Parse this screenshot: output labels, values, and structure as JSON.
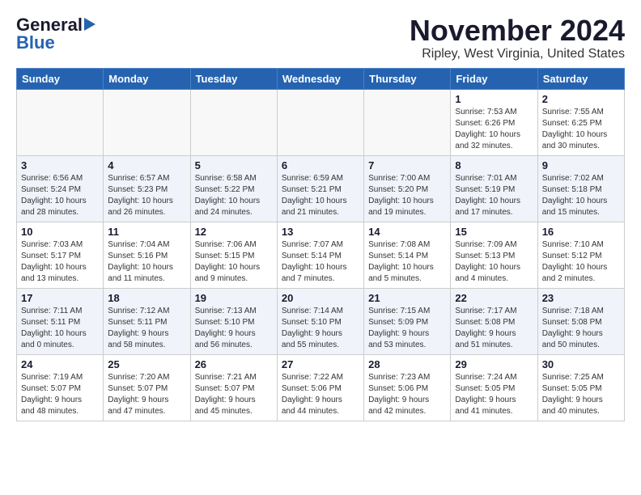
{
  "header": {
    "logo_general": "General",
    "logo_blue": "Blue",
    "title": "November 2024",
    "subtitle": "Ripley, West Virginia, United States"
  },
  "weekdays": [
    "Sunday",
    "Monday",
    "Tuesday",
    "Wednesday",
    "Thursday",
    "Friday",
    "Saturday"
  ],
  "weeks": [
    {
      "shaded": false,
      "days": [
        {
          "num": "",
          "info": ""
        },
        {
          "num": "",
          "info": ""
        },
        {
          "num": "",
          "info": ""
        },
        {
          "num": "",
          "info": ""
        },
        {
          "num": "",
          "info": ""
        },
        {
          "num": "1",
          "info": "Sunrise: 7:53 AM\nSunset: 6:26 PM\nDaylight: 10 hours\nand 32 minutes."
        },
        {
          "num": "2",
          "info": "Sunrise: 7:55 AM\nSunset: 6:25 PM\nDaylight: 10 hours\nand 30 minutes."
        }
      ]
    },
    {
      "shaded": true,
      "days": [
        {
          "num": "3",
          "info": "Sunrise: 6:56 AM\nSunset: 5:24 PM\nDaylight: 10 hours\nand 28 minutes."
        },
        {
          "num": "4",
          "info": "Sunrise: 6:57 AM\nSunset: 5:23 PM\nDaylight: 10 hours\nand 26 minutes."
        },
        {
          "num": "5",
          "info": "Sunrise: 6:58 AM\nSunset: 5:22 PM\nDaylight: 10 hours\nand 24 minutes."
        },
        {
          "num": "6",
          "info": "Sunrise: 6:59 AM\nSunset: 5:21 PM\nDaylight: 10 hours\nand 21 minutes."
        },
        {
          "num": "7",
          "info": "Sunrise: 7:00 AM\nSunset: 5:20 PM\nDaylight: 10 hours\nand 19 minutes."
        },
        {
          "num": "8",
          "info": "Sunrise: 7:01 AM\nSunset: 5:19 PM\nDaylight: 10 hours\nand 17 minutes."
        },
        {
          "num": "9",
          "info": "Sunrise: 7:02 AM\nSunset: 5:18 PM\nDaylight: 10 hours\nand 15 minutes."
        }
      ]
    },
    {
      "shaded": false,
      "days": [
        {
          "num": "10",
          "info": "Sunrise: 7:03 AM\nSunset: 5:17 PM\nDaylight: 10 hours\nand 13 minutes."
        },
        {
          "num": "11",
          "info": "Sunrise: 7:04 AM\nSunset: 5:16 PM\nDaylight: 10 hours\nand 11 minutes."
        },
        {
          "num": "12",
          "info": "Sunrise: 7:06 AM\nSunset: 5:15 PM\nDaylight: 10 hours\nand 9 minutes."
        },
        {
          "num": "13",
          "info": "Sunrise: 7:07 AM\nSunset: 5:14 PM\nDaylight: 10 hours\nand 7 minutes."
        },
        {
          "num": "14",
          "info": "Sunrise: 7:08 AM\nSunset: 5:14 PM\nDaylight: 10 hours\nand 5 minutes."
        },
        {
          "num": "15",
          "info": "Sunrise: 7:09 AM\nSunset: 5:13 PM\nDaylight: 10 hours\nand 4 minutes."
        },
        {
          "num": "16",
          "info": "Sunrise: 7:10 AM\nSunset: 5:12 PM\nDaylight: 10 hours\nand 2 minutes."
        }
      ]
    },
    {
      "shaded": true,
      "days": [
        {
          "num": "17",
          "info": "Sunrise: 7:11 AM\nSunset: 5:11 PM\nDaylight: 10 hours\nand 0 minutes."
        },
        {
          "num": "18",
          "info": "Sunrise: 7:12 AM\nSunset: 5:11 PM\nDaylight: 9 hours\nand 58 minutes."
        },
        {
          "num": "19",
          "info": "Sunrise: 7:13 AM\nSunset: 5:10 PM\nDaylight: 9 hours\nand 56 minutes."
        },
        {
          "num": "20",
          "info": "Sunrise: 7:14 AM\nSunset: 5:10 PM\nDaylight: 9 hours\nand 55 minutes."
        },
        {
          "num": "21",
          "info": "Sunrise: 7:15 AM\nSunset: 5:09 PM\nDaylight: 9 hours\nand 53 minutes."
        },
        {
          "num": "22",
          "info": "Sunrise: 7:17 AM\nSunset: 5:08 PM\nDaylight: 9 hours\nand 51 minutes."
        },
        {
          "num": "23",
          "info": "Sunrise: 7:18 AM\nSunset: 5:08 PM\nDaylight: 9 hours\nand 50 minutes."
        }
      ]
    },
    {
      "shaded": false,
      "days": [
        {
          "num": "24",
          "info": "Sunrise: 7:19 AM\nSunset: 5:07 PM\nDaylight: 9 hours\nand 48 minutes."
        },
        {
          "num": "25",
          "info": "Sunrise: 7:20 AM\nSunset: 5:07 PM\nDaylight: 9 hours\nand 47 minutes."
        },
        {
          "num": "26",
          "info": "Sunrise: 7:21 AM\nSunset: 5:07 PM\nDaylight: 9 hours\nand 45 minutes."
        },
        {
          "num": "27",
          "info": "Sunrise: 7:22 AM\nSunset: 5:06 PM\nDaylight: 9 hours\nand 44 minutes."
        },
        {
          "num": "28",
          "info": "Sunrise: 7:23 AM\nSunset: 5:06 PM\nDaylight: 9 hours\nand 42 minutes."
        },
        {
          "num": "29",
          "info": "Sunrise: 7:24 AM\nSunset: 5:05 PM\nDaylight: 9 hours\nand 41 minutes."
        },
        {
          "num": "30",
          "info": "Sunrise: 7:25 AM\nSunset: 5:05 PM\nDaylight: 9 hours\nand 40 minutes."
        }
      ]
    }
  ]
}
